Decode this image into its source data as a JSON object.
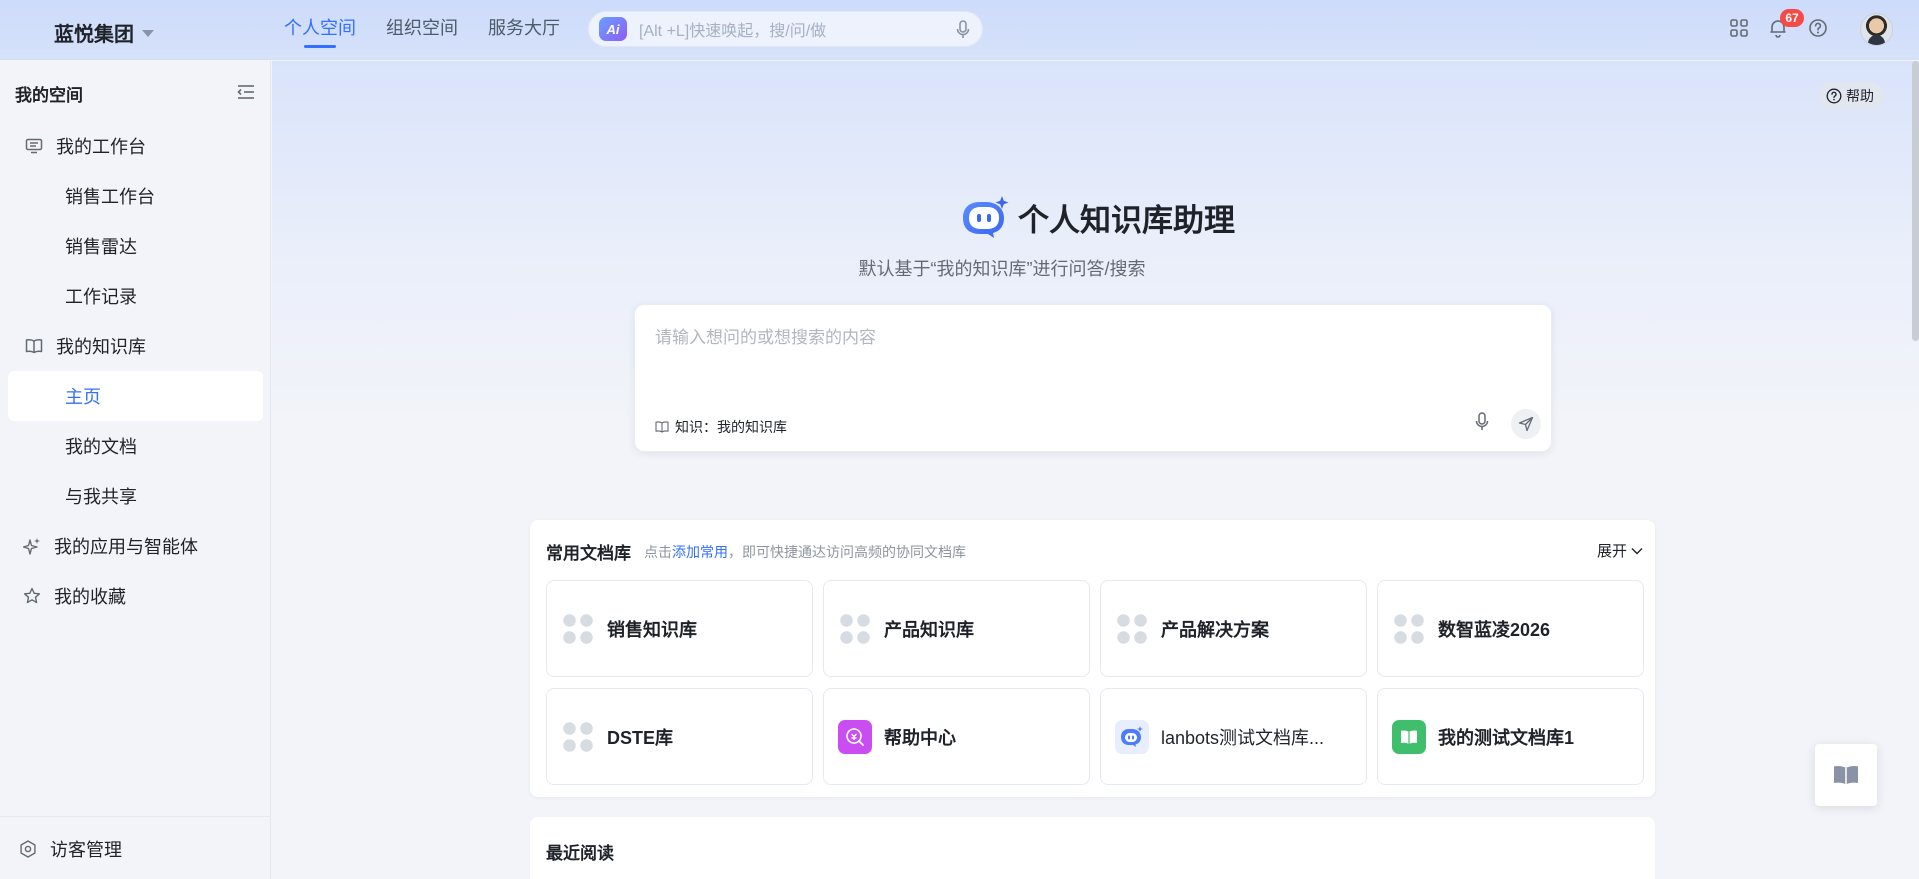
{
  "header": {
    "org_name": "蓝悦集团",
    "nav": [
      "个人空间",
      "组织空间",
      "服务大厅"
    ],
    "search": {
      "badge": "Ai",
      "placeholder": "[Alt +L]快速唤起，搜/问/做"
    },
    "notification_count": "67"
  },
  "sidebar": {
    "title": "我的空间",
    "items": [
      {
        "label": "我的工作台",
        "icon": "workbench-icon"
      },
      {
        "label": "销售工作台"
      },
      {
        "label": "销售雷达"
      },
      {
        "label": "工作记录"
      },
      {
        "label": "我的知识库",
        "icon": "book-icon"
      },
      {
        "label": "主页",
        "active": true
      },
      {
        "label": "我的文档"
      },
      {
        "label": "与我共享"
      },
      {
        "label": "我的应用与智能体",
        "icon": "sparkle-icon"
      },
      {
        "label": "我的收藏",
        "icon": "star-icon"
      }
    ],
    "footer": "访客管理"
  },
  "main": {
    "help_label": "帮助",
    "hero_title": "个人知识库助理",
    "hero_subtitle": "默认基于“我的知识库”进行问答/搜索",
    "ask_placeholder": "请输入想问的或想搜索的内容",
    "ask_kb": "知识：我的知识库",
    "common": {
      "title": "常用文档库",
      "hint_prefix": "点击",
      "hint_link": "添加常用",
      "hint_suffix": "，即可快捷通达访问高频的协同文档库",
      "expand": "展开",
      "libraries": [
        {
          "name": "销售知识库",
          "icon": "grid"
        },
        {
          "name": "产品知识库",
          "icon": "grid"
        },
        {
          "name": "产品解决方案",
          "icon": "grid"
        },
        {
          "name": "数智蓝凌2026",
          "icon": "grid"
        },
        {
          "name": "DSTE库",
          "icon": "grid"
        },
        {
          "name": "帮助中心",
          "icon": "help-center",
          "color": "#c94df0"
        },
        {
          "name": "lanbots测试文档库...",
          "icon": "bot",
          "color": "#e8eefc"
        },
        {
          "name": "我的测试文档库1",
          "icon": "book",
          "color": "#3fbf6b"
        }
      ]
    },
    "recent_title": "最近阅读"
  },
  "colors": {
    "accent": "#3370ff",
    "badge": "#f54a45"
  }
}
